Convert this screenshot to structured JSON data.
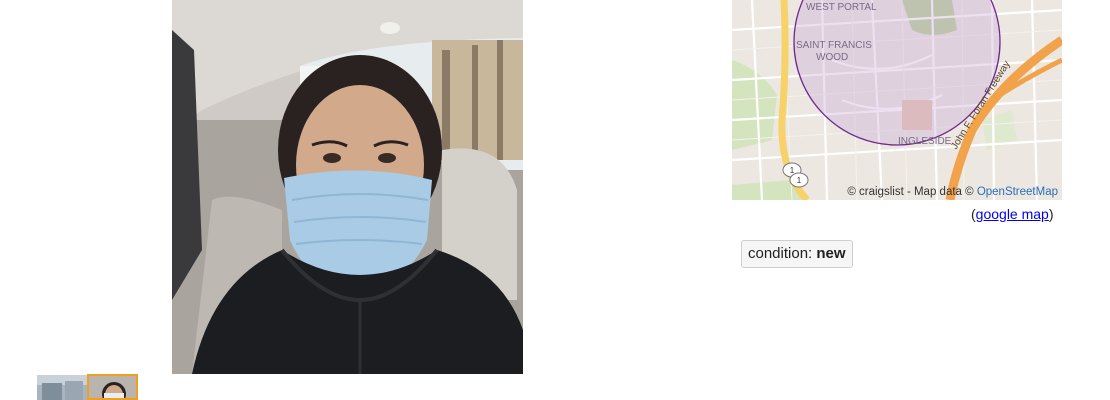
{
  "gallery": {
    "thumbnail_count": 2,
    "selected_thumbnail": 2
  },
  "map": {
    "labels": {
      "west_portal": "WEST PORTAL",
      "saint_francis_line1": "SAINT FRANCIS",
      "saint_francis_line2": "WOOD",
      "freeway": "John F. Foran Freeway",
      "ingleside": "INGLESIDE",
      "route_shield_1": "1",
      "route_shield_2": "1"
    },
    "attribution_prefix": "© craigslist - Map data ©",
    "attribution_link": "OpenStreetMap",
    "google_map_open": "(",
    "google_map_link": "google map",
    "google_map_close": ")"
  },
  "attributes": {
    "condition_label": "condition:",
    "condition_value": "new"
  }
}
